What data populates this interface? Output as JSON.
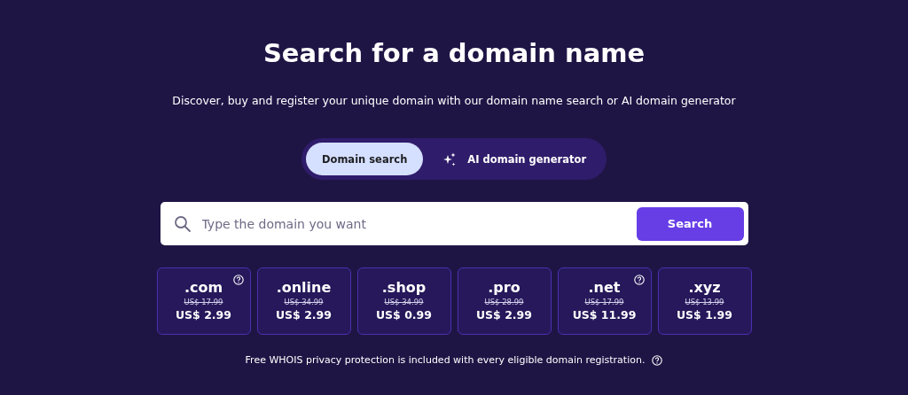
{
  "title": "Search for a domain name",
  "subtitle": "Discover, buy and register your unique domain with our domain name search or AI domain generator",
  "tabs": [
    {
      "label": "Domain search",
      "selected": true,
      "kind": "plain"
    },
    {
      "label": "AI domain generator",
      "selected": false,
      "kind": "sparkle"
    }
  ],
  "search": {
    "placeholder": "Type the domain you want",
    "button": "Search"
  },
  "domains": [
    {
      "tld": ".com",
      "old_price": "US$ 17.99",
      "price": "US$ 2.99",
      "help": true
    },
    {
      "tld": ".online",
      "old_price": "US$ 34.99",
      "price": "US$ 2.99",
      "help": false
    },
    {
      "tld": ".shop",
      "old_price": "US$ 34.99",
      "price": "US$ 0.99",
      "help": false
    },
    {
      "tld": ".pro",
      "old_price": "US$ 28.99",
      "price": "US$ 2.99",
      "help": false
    },
    {
      "tld": ".net",
      "old_price": "US$ 17.99",
      "price": "US$ 11.99",
      "help": true
    },
    {
      "tld": ".xyz",
      "old_price": "US$ 13.99",
      "price": "US$ 1.99",
      "help": false
    }
  ],
  "footnote": "Free WHOIS privacy protection is included with every eligible domain registration."
}
